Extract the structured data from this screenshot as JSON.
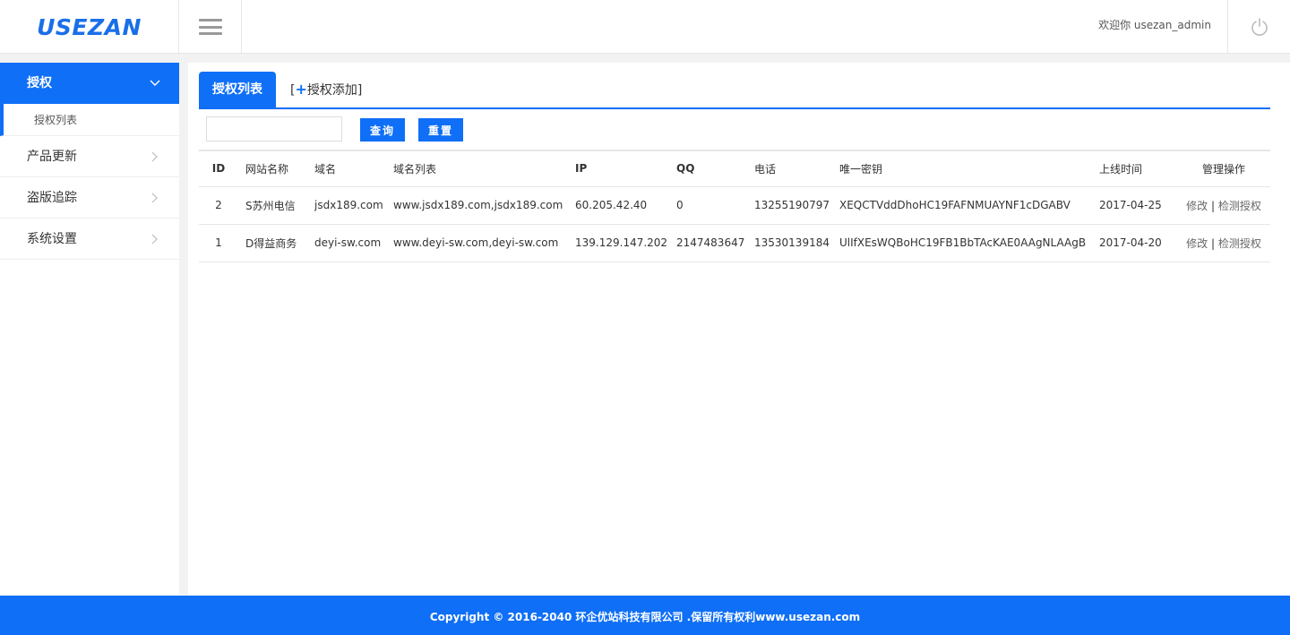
{
  "header": {
    "logo": "USEZAN",
    "welcome": "欢迎你 usezan_admin",
    "menu_icon": "hamburger-icon",
    "power_icon": "power-icon"
  },
  "sidebar": {
    "items": [
      {
        "label": "授权",
        "active": true,
        "icon": "chevron-down-icon"
      },
      {
        "label": "产品更新",
        "icon": "chevron-right-icon"
      },
      {
        "label": "盗版追踪",
        "icon": "chevron-right-icon"
      },
      {
        "label": "系统设置",
        "icon": "chevron-right-icon"
      }
    ],
    "sub_items": [
      {
        "label": "授权列表"
      }
    ]
  },
  "tabs": {
    "active": "授权列表",
    "add_prefix": "[",
    "add_plus": "+",
    "add_label": "授权添加]"
  },
  "toolbar": {
    "search_value": "",
    "search_placeholder": "",
    "query_label": "查询",
    "reset_label": "重置"
  },
  "table": {
    "headers": [
      "ID",
      "网站名称",
      "域名",
      "域名列表",
      "IP",
      "QQ",
      "电话",
      "唯一密钥",
      "上线时间",
      "管理操作"
    ],
    "rows": [
      {
        "id": "2",
        "name": "S苏州电信",
        "domain": "jsdx189.com",
        "domains": "www.jsdx189.com,jsdx189.com",
        "ip": "60.205.42.40",
        "qq": "0",
        "phone": "13255190797",
        "key": "XEQCTVddDhoHC19FAFNMUAYNF1cDGABV",
        "date": "2017-04-25",
        "op_edit": "修改",
        "op_sep": " | ",
        "op_check": "检测授权"
      },
      {
        "id": "1",
        "name": "D得益商务",
        "domain": "deyi-sw.com",
        "domains": "www.deyi-sw.com,deyi-sw.com",
        "ip": "139.129.147.202",
        "qq": "2147483647",
        "phone": "13530139184",
        "key": "UlIfXEsWQBoHC19FB1BbTAcKAE0AAgNLAAgB",
        "date": "2017-04-20",
        "op_edit": "修改",
        "op_sep": " | ",
        "op_check": "检测授权"
      }
    ]
  },
  "footer": {
    "text": "Copyright © 2016-2040 环企优站科技有限公司 .保留所有权利www.usezan.com"
  },
  "colors": {
    "primary": "#0f6ff6",
    "logo": "#1a6fe8"
  }
}
